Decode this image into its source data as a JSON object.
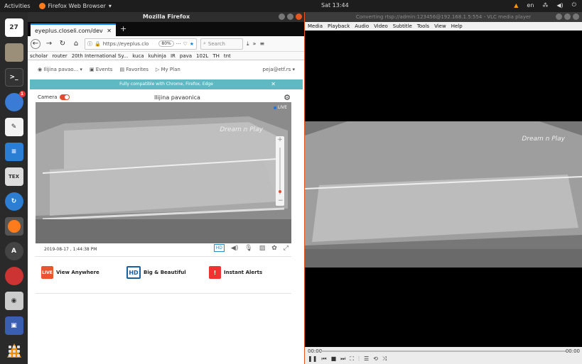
{
  "topbar": {
    "activities": "Activities",
    "app_name": "Firefox Web Browser",
    "clock": "Sat 13:44",
    "lang": "en"
  },
  "dock": {
    "items": [
      "27",
      "mail",
      "",
      "",
      "",
      "TEX",
      "",
      "firefox",
      "",
      "",
      "",
      "vlc"
    ],
    "badge": "1"
  },
  "firefox": {
    "window_title": "Mozilla Firefox",
    "tab_label": "eyeplus.closeli.com/dev",
    "url": "https://eyeplus.clo",
    "zoom": "80%",
    "search_placeholder": "Search",
    "bookmarks": [
      "scholar",
      "router",
      "20th International Sy...",
      "kuca",
      "kuhinja",
      "IR",
      "pava",
      "102L",
      "TH",
      "tnt"
    ]
  },
  "site": {
    "nav": [
      "Ilijina pavao...",
      "Events",
      "Favorites",
      "My Plan"
    ],
    "user": "peja@etf.rs",
    "banner": "Fully compatible with Chrome, Firefox, Edge",
    "camera_label": "Camera",
    "camera_name": "Ilijina pavaonica",
    "live": "LIVE",
    "watermark": "Dream n Play",
    "timestamp": "2019-08-17 , 1:44:38 PM",
    "hd_label": "HD",
    "features": [
      {
        "label": "View Anywhere",
        "icon": "LIVE"
      },
      {
        "label": "Big & Beautiful",
        "icon": "HD"
      },
      {
        "label": "Instant Alerts",
        "icon": "!"
      }
    ]
  },
  "vlc": {
    "title": "Converting rtsp://admin:123456@192.168.1.5:554 - VLC media player",
    "menu": [
      "Media",
      "Playback",
      "Audio",
      "Video",
      "Subtitle",
      "Tools",
      "View",
      "Help"
    ],
    "time_left": "00:00",
    "time_right": "00:00"
  }
}
